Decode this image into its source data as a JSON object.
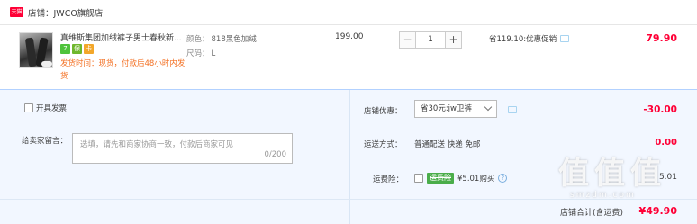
{
  "store": {
    "badge": "天猫",
    "name": "店铺：JWCO旗舰店"
  },
  "item": {
    "title": "真维斯集团加绒裤子男士春秋新...",
    "services": [
      "7",
      "保",
      "卡"
    ],
    "ship_note": "发货时间：现货，付款后48小时内发货",
    "sku": [
      {
        "label": "颜色：",
        "value": "818黑色加绒"
      },
      {
        "label": "尺码：",
        "value": "L"
      }
    ],
    "price": "199.00",
    "quantity": "1",
    "minus": "−",
    "plus": "+",
    "promo": "省119.10:优惠促销",
    "total": "79.90"
  },
  "order": {
    "deliver_check_label": "开具发票",
    "message_label": "给卖家留言：",
    "message_placeholder": "选填，请先和商家协商一致，付款后商家可见",
    "message_count": "0/200",
    "store_promo_label": "店铺优惠：",
    "store_promo_value": "省30元:jw卫裤",
    "store_promo_amount": "-30.00",
    "shipping_label": "运送方式：",
    "shipping_value": "普通配送 快递 免邮",
    "shipping_amount": "0.00",
    "insurance_label": "运费险：",
    "insurance_tag": "运费险",
    "insurance_value": "¥5.01购买",
    "insurance_help": "?",
    "insurance_amount": "5.01",
    "store_total_label": "店铺合计(含运费)",
    "store_total_amount": "¥49.90"
  },
  "watermark": {
    "main": "值值值",
    "sub": "smzdm.com"
  }
}
